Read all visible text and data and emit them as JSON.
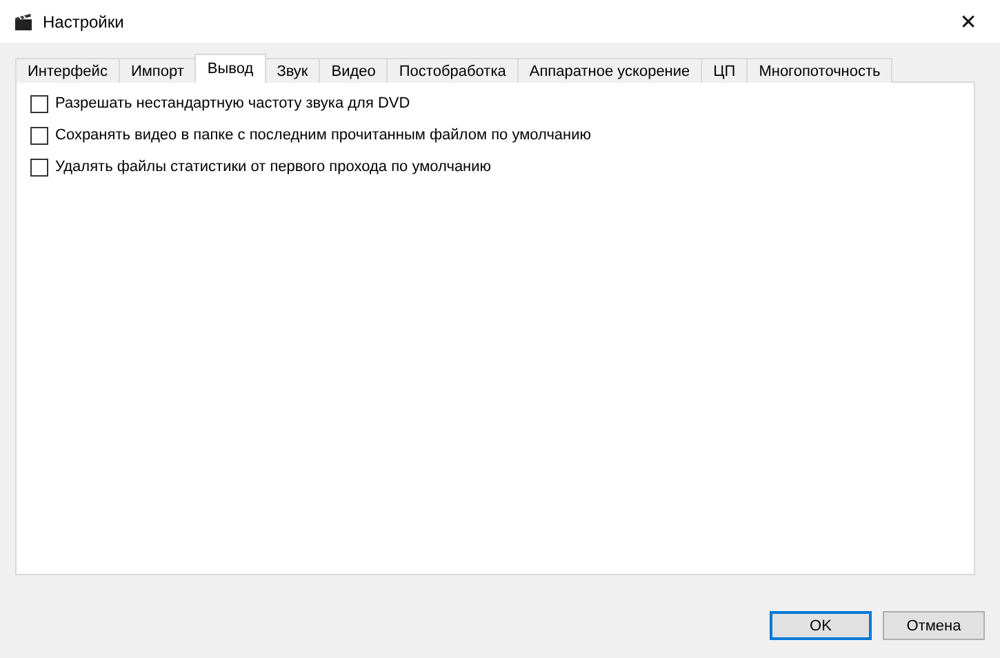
{
  "window": {
    "title": "Настройки",
    "close": "✕"
  },
  "tabs": [
    {
      "label": "Интерфейс",
      "selected": false
    },
    {
      "label": "Импорт",
      "selected": false
    },
    {
      "label": "Вывод",
      "selected": true
    },
    {
      "label": "Звук",
      "selected": false
    },
    {
      "label": "Видео",
      "selected": false
    },
    {
      "label": "Постобработка",
      "selected": false
    },
    {
      "label": "Аппаратное ускорение",
      "selected": false
    },
    {
      "label": "ЦП",
      "selected": false
    },
    {
      "label": "Многопоточность",
      "selected": false
    }
  ],
  "options": [
    {
      "label": "Разрешать нестандартную частоту звука для DVD",
      "checked": false
    },
    {
      "label": "Сохранять видео в папке с последним прочитанным файлом по умолчанию",
      "checked": false
    },
    {
      "label": "Удалять файлы статистики от первого прохода по умолчанию",
      "checked": false
    }
  ],
  "buttons": [
    {
      "label": "OK",
      "default": true
    },
    {
      "label": "Отмена",
      "default": false
    }
  ]
}
